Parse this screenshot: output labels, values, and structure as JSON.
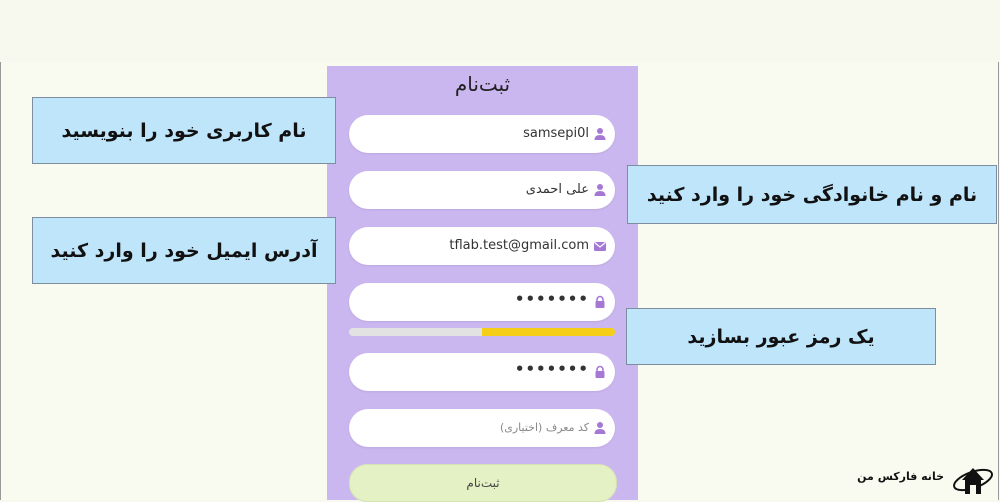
{
  "form": {
    "title": "ثبت‌نام",
    "username_value": "samsepi0l",
    "fullname_value": "علی احمدی",
    "email_value": "tflab.test@gmail.com",
    "password_value": "•••••••",
    "password_strength": 0.5,
    "confirm_password_value": "•••••••",
    "referral_placeholder": "کد معرف (اختیاری)",
    "submit_label": "ثبت‌نام"
  },
  "annotations": {
    "username_hint": "نام کاربری خود را بنویسید",
    "fullname_hint": "نام و نام خانوادگی خود را وارد کنید",
    "email_hint": "آدرس ایمیل خود را وارد کنید",
    "password_hint": "یک رمز عبور بسازید"
  },
  "brand": {
    "name": "خانه فارکس من"
  },
  "colors": {
    "panel": "#cbb7f0",
    "icon": "#a678d6",
    "strength": "#f5cf17",
    "callout": "#bfe5fb",
    "submit": "#e4f1c4"
  },
  "icons": {
    "user": "user-icon",
    "email": "envelope-icon",
    "lock": "lock-icon"
  }
}
